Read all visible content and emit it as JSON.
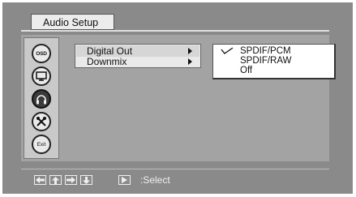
{
  "screen": {
    "title": "Audio Setup"
  },
  "sidebar": {
    "items": [
      {
        "icon": "osd-icon",
        "label": "OSD"
      },
      {
        "icon": "monitor-icon"
      },
      {
        "icon": "headphones-icon",
        "active": true
      },
      {
        "icon": "tools-icon"
      },
      {
        "icon": "exit-icon",
        "label": "Exit"
      }
    ]
  },
  "menu": {
    "items": [
      {
        "label": "Digital Out",
        "selected": true
      },
      {
        "label": "Downmix"
      }
    ]
  },
  "submenu": {
    "items": [
      {
        "label": "SPDIF/PCM",
        "checked": true
      },
      {
        "label": "SPDIF/RAW"
      },
      {
        "label": "Off"
      }
    ]
  },
  "footer": {
    "nav_icons": [
      "arrow-left-icon",
      "arrow-up-icon",
      "arrow-right-icon",
      "arrow-down-icon"
    ],
    "play_icon": "play-icon",
    "hint": ":Select"
  },
  "colors": {
    "frame": "#8a8a8a",
    "panel": "#a3a3a3",
    "sidebar": "#c9c9c9",
    "active_icon": "#3a3a3a"
  }
}
